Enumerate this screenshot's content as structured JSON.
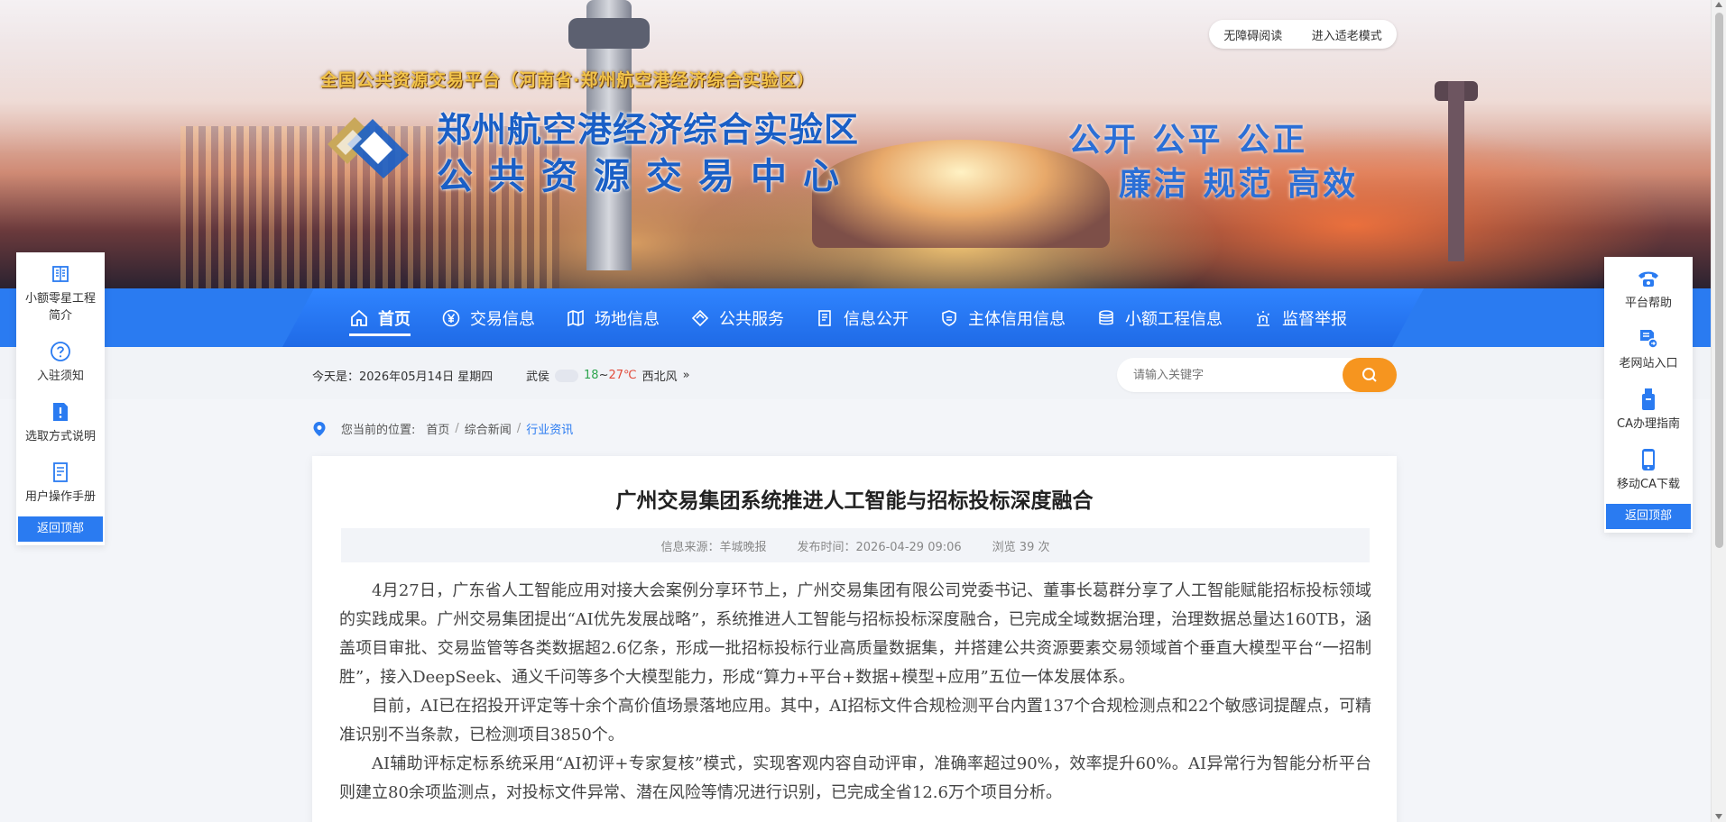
{
  "header": {
    "platform_title": "全国公共资源交易平台（河南省·郑州航空港经济综合实验区）",
    "org_line1": "郑州航空港经济综合实验区",
    "org_line2": "公共资源交易中心",
    "slogan_line1": "公开  公平  公正",
    "slogan_line2": "廉洁  规范  高效",
    "accessibility": "无障碍阅读",
    "elder_mode": "进入适老模式"
  },
  "nav": {
    "items": [
      {
        "label": "首页",
        "icon": "home-icon"
      },
      {
        "label": "交易信息",
        "icon": "yen-icon"
      },
      {
        "label": "场地信息",
        "icon": "map-icon"
      },
      {
        "label": "公共服务",
        "icon": "diamond-icon"
      },
      {
        "label": "信息公开",
        "icon": "document-icon"
      },
      {
        "label": "主体信用信息",
        "icon": "shield-icon"
      },
      {
        "label": "小额工程信息",
        "icon": "database-icon"
      },
      {
        "label": "监督举报",
        "icon": "lamp-icon"
      }
    ],
    "active": "首页"
  },
  "infobar": {
    "date": "今天是：2026年05月14日 星期四",
    "city": "武侯",
    "temp_low": "18",
    "temp_sep": "~",
    "temp_high": "27℃",
    "wind": "西北风",
    "more": "»",
    "search_placeholder": "请输入关键字"
  },
  "breadcrumb": {
    "label": "您当前的位置:",
    "items": [
      "首页",
      "综合新闻",
      "行业资讯"
    ],
    "separator": "/"
  },
  "article": {
    "title": "广州交易集团系统推进人工智能与招标投标深度融合",
    "source": "信息来源：羊城晚报",
    "published": "发布时间：2026-04-29 09:06",
    "views": "浏览 39 次",
    "paragraphs": [
      "4月27日，广东省人工智能应用对接大会案例分享环节上，广州交易集团有限公司党委书记、董事长葛群分享了人工智能赋能招标投标领域的实践成果。广州交易集团提出“AI优先发展战略”，系统推进人工智能与招标投标深度融合，已完成全域数据治理，治理数据总量达160TB，涵盖项目审批、交易监管等各类数据超2.6亿条，形成一批招标投标行业高质量数据集，并搭建公共资源要素交易领域首个垂直大模型平台“一招制胜”，接入DeepSeek、通义千问等多个大模型能力，形成“算力+平台+数据+模型+应用”五位一体发展体系。",
      "目前，AI已在招投开评定等十余个高价值场景落地应用。其中，AI招标文件合规检测平台内置137个合规检测点和22个敏感词提醒点，可精准识别不当条款，已检测项目3850个。",
      "AI辅助评标定标系统采用“AI初评+专家复核”模式，实现客观内容自动评审，准确率超过90%，效率提升60%。AI异常行为智能分析平台则建立80余项监测点，对投标文件异常、潜在风险等情况进行识别，已完成全省12.6万个项目分析。"
    ]
  },
  "side_left": {
    "items": [
      {
        "label": "小额零星工程简介",
        "icon": "book-icon"
      },
      {
        "label": "入驻须知",
        "icon": "question-icon"
      },
      {
        "label": "选取方式说明",
        "icon": "exclamation-doc-icon"
      },
      {
        "label": "用户操作手册",
        "icon": "manual-icon"
      }
    ],
    "back_top": "返回顶部"
  },
  "side_right": {
    "items": [
      {
        "label": "平台帮助",
        "icon": "phone-icon"
      },
      {
        "label": "老网站入口",
        "icon": "old-site-icon"
      },
      {
        "label": "CA办理指南",
        "icon": "usb-key-icon"
      },
      {
        "label": "移动CA下载",
        "icon": "mobile-icon"
      }
    ],
    "back_top": "返回顶部"
  },
  "colors": {
    "primary": "#2a7bf1",
    "search_button": "#f6951f",
    "title_blue": "#1a5fc6",
    "gold": "#f2c44a"
  }
}
